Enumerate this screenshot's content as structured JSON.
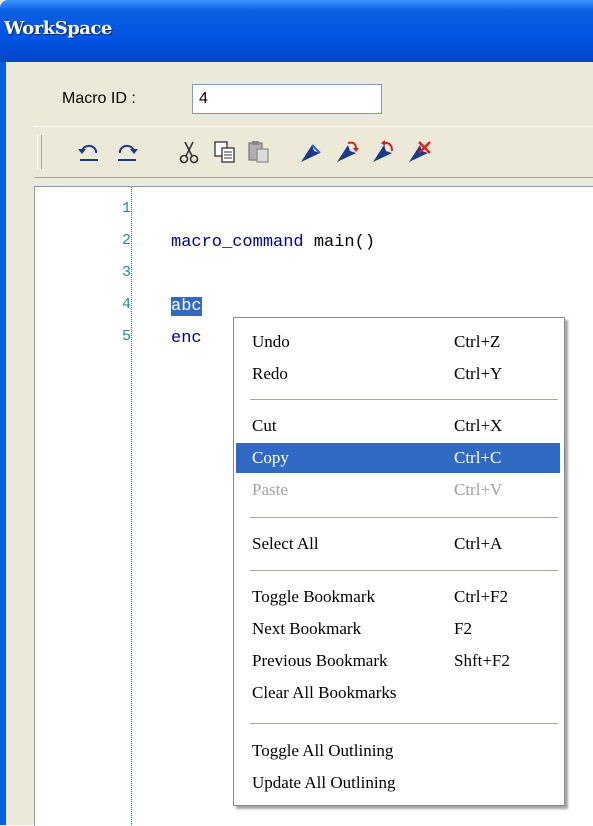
{
  "window": {
    "title": "WorkSpace"
  },
  "macro": {
    "label": "Macro ID :",
    "value": "4"
  },
  "toolbar": {
    "icons": [
      "undo-icon",
      "redo-icon",
      "cut-icon",
      "copy-icon",
      "paste-icon",
      "toggle-bookmark-icon",
      "next-bookmark-icon",
      "previous-bookmark-icon",
      "clear-bookmarks-icon"
    ]
  },
  "editor": {
    "lines": [
      {
        "number": "1",
        "text": ""
      },
      {
        "number": "2",
        "keyword": "macro_command",
        "rest": " main()"
      },
      {
        "number": "3",
        "text": ""
      },
      {
        "number": "4",
        "selected": "abc",
        "rest": ""
      },
      {
        "number": "5",
        "visible": "enc"
      }
    ]
  },
  "context_menu": {
    "items": [
      {
        "label": "Undo",
        "shortcut": "Ctrl+Z",
        "state": "normal"
      },
      {
        "label": "Redo",
        "shortcut": "Ctrl+Y",
        "state": "normal"
      },
      {
        "label": "Cut",
        "shortcut": "Ctrl+X",
        "state": "normal"
      },
      {
        "label": "Copy",
        "shortcut": "Ctrl+C",
        "state": "highlighted"
      },
      {
        "label": "Paste",
        "shortcut": "Ctrl+V",
        "state": "disabled"
      },
      {
        "label": "Select All",
        "shortcut": "Ctrl+A",
        "state": "normal"
      },
      {
        "label": "Toggle Bookmark",
        "shortcut": "Ctrl+F2",
        "state": "normal"
      },
      {
        "label": "Next Bookmark",
        "shortcut": "F2",
        "state": "normal"
      },
      {
        "label": "Previous Bookmark",
        "shortcut": "Shft+F2",
        "state": "normal"
      },
      {
        "label": "Clear All Bookmarks",
        "shortcut": "",
        "state": "normal"
      },
      {
        "label": "Toggle All Outlining",
        "shortcut": "",
        "state": "normal"
      },
      {
        "label": "Update All Outlining",
        "shortcut": "",
        "state": "normal"
      }
    ]
  },
  "colors": {
    "selection": "#316ac5",
    "titlebar": "#0054e3",
    "gutter_numbers": "#2a8a8a",
    "keyword": "#0000a0"
  }
}
